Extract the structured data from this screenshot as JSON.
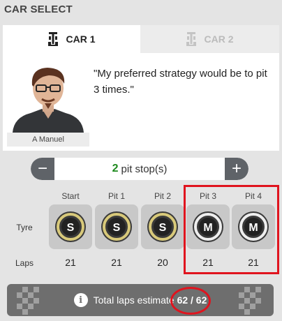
{
  "header": {
    "title": "CAR SELECT"
  },
  "tabs": [
    {
      "label": "CAR 1",
      "active": true,
      "icon": "car-icon"
    },
    {
      "label": "CAR 2",
      "active": false,
      "icon": "car-icon"
    }
  ],
  "driver": {
    "name": "A Manuel",
    "quote": "\"My preferred strategy would be to pit 3 times.\""
  },
  "stepper": {
    "count": "2",
    "label": "pit stop(s)",
    "minus": "−",
    "plus": "+"
  },
  "strategy": {
    "row_labels": {
      "tyre": "Tyre",
      "laps": "Laps"
    },
    "columns": [
      {
        "header": "Start",
        "compound": "S",
        "laps": "21"
      },
      {
        "header": "Pit 1",
        "compound": "S",
        "laps": "21"
      },
      {
        "header": "Pit 2",
        "compound": "S",
        "laps": "20"
      },
      {
        "header": "Pit 3",
        "compound": "M",
        "laps": "21"
      },
      {
        "header": "Pit 4",
        "compound": "M",
        "laps": "21"
      }
    ]
  },
  "total": {
    "info_icon": "i",
    "label": "Total laps estimate",
    "value": "62 / 62"
  },
  "colors": {
    "soft_ring": "#d8c97a",
    "medium_ring": "#eeeeee",
    "highlight": "#e0141e",
    "stop_count": "#1e8a1e"
  }
}
